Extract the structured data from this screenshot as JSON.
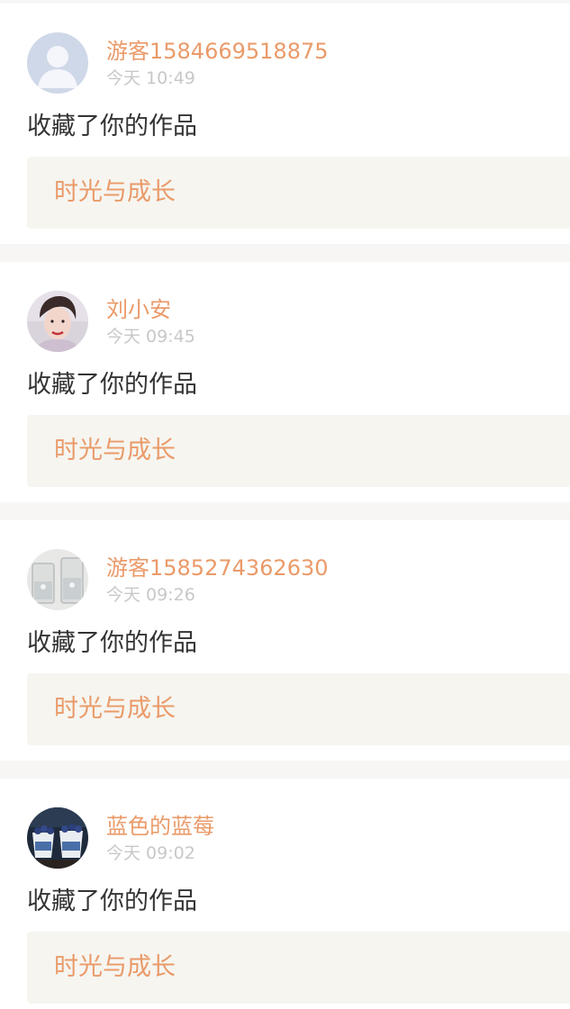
{
  "notifications": [
    {
      "avatar": "default-person-avatar",
      "username": "游客1584669518875",
      "time": "今天 10:49",
      "action": "收藏了你的作品",
      "work_title": "时光与成长"
    },
    {
      "avatar": "woman-photo-avatar",
      "username": "刘小安",
      "time": "今天 09:45",
      "action": "收藏了你的作品",
      "work_title": "时光与成长"
    },
    {
      "avatar": "glasses-photo-avatar",
      "username": "游客1585274362630",
      "time": "今天 09:26",
      "action": "收藏了你的作品",
      "work_title": "时光与成长"
    },
    {
      "avatar": "blueberry-cups-photo-avatar",
      "username": "蓝色的蓝莓",
      "time": "今天 09:02",
      "action": "收藏了你的作品",
      "work_title": "时光与成长"
    }
  ],
  "colors": {
    "username": "#ea9a69",
    "work_title": "#ea9a69",
    "time": "#c8c8c8",
    "action": "#333333",
    "work_box_bg": "#f6f5f0",
    "separator_bg": "#f8f6f5"
  }
}
